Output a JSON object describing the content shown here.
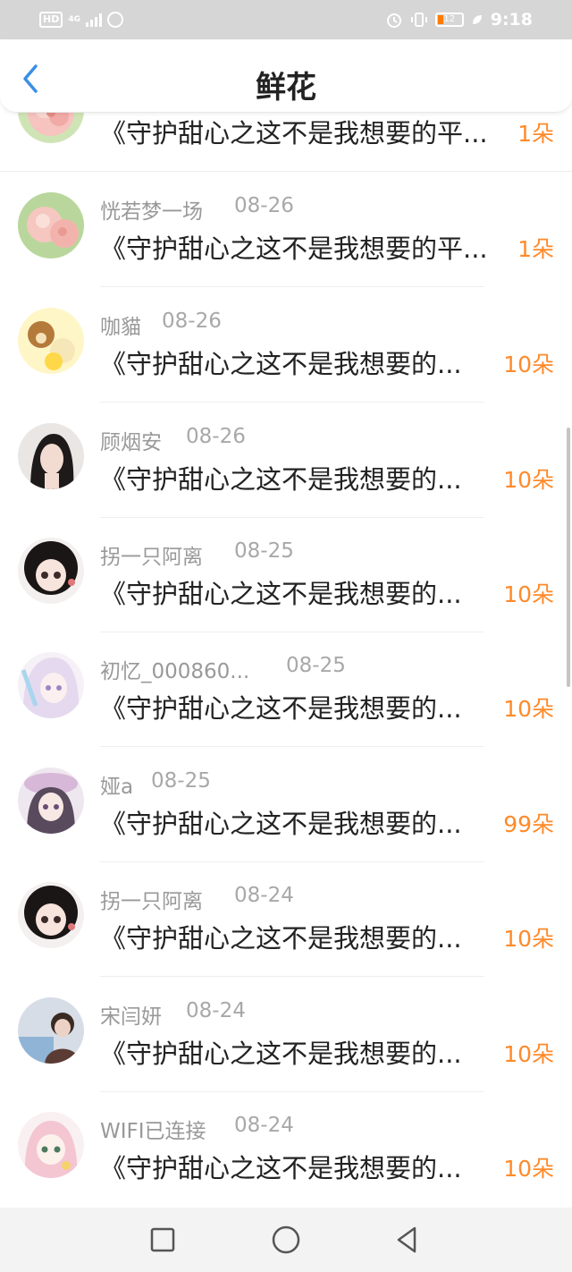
{
  "status_bar": {
    "hd": "HD",
    "network": "4G",
    "battery_level": "12",
    "time": "9:18",
    "icons": [
      "signal-icon",
      "loading-ring-icon",
      "alarm-icon",
      "vibrate-icon",
      "battery-icon",
      "leaf-icon"
    ]
  },
  "header": {
    "title": "鲜花",
    "back_icon": "chevron-left-icon"
  },
  "colors": {
    "accent": "#3a8ee6",
    "count": "#ff8a2a",
    "meta_text": "#999999"
  },
  "gifts": [
    {
      "user": "",
      "date": "",
      "message": "《守护甜心之这不是我想要的平...",
      "count": "1朵",
      "avatar": "pink-flower-avatar"
    },
    {
      "user": "恍若梦一场",
      "date": "08-26",
      "message": "《守护甜心之这不是我想要的平...",
      "count": "1朵",
      "avatar": "pink-flower-avatar"
    },
    {
      "user": "咖貓",
      "date": "08-26",
      "message": "《守护甜心之这不是我想要的...",
      "count": "10朵",
      "avatar": "bear-avatar"
    },
    {
      "user": "顾烟安",
      "date": "08-26",
      "message": "《守护甜心之这不是我想要的...",
      "count": "10朵",
      "avatar": "girl-portrait-avatar"
    },
    {
      "user": "拐一只阿离",
      "date": "08-25",
      "message": "《守护甜心之这不是我想要的...",
      "count": "10朵",
      "avatar": "anime-girl-dark-avatar"
    },
    {
      "user": "初忆_000860...",
      "date": "08-25",
      "message": "《守护甜心之这不是我想要的...",
      "count": "10朵",
      "avatar": "anime-girl-pastel-avatar"
    },
    {
      "user": "娅a",
      "date": "08-25",
      "message": "《守护甜心之这不是我想要的...",
      "count": "99朵",
      "avatar": "anime-girl-hat-avatar"
    },
    {
      "user": "拐一只阿离",
      "date": "08-24",
      "message": "《守护甜心之这不是我想要的...",
      "count": "10朵",
      "avatar": "anime-girl-dark-avatar"
    },
    {
      "user": "宋闫妍",
      "date": "08-24",
      "message": "《守护甜心之这不是我想要的...",
      "count": "10朵",
      "avatar": "boy-photo-avatar"
    },
    {
      "user": "WIFI已连接",
      "date": "08-24",
      "message": "《守护甜心之这不是我想要的...",
      "count": "10朵",
      "avatar": "anime-girl-pink-avatar"
    }
  ],
  "navbar": {
    "icons": [
      "recent-apps-square-icon",
      "home-circle-icon",
      "back-triangle-icon"
    ]
  }
}
